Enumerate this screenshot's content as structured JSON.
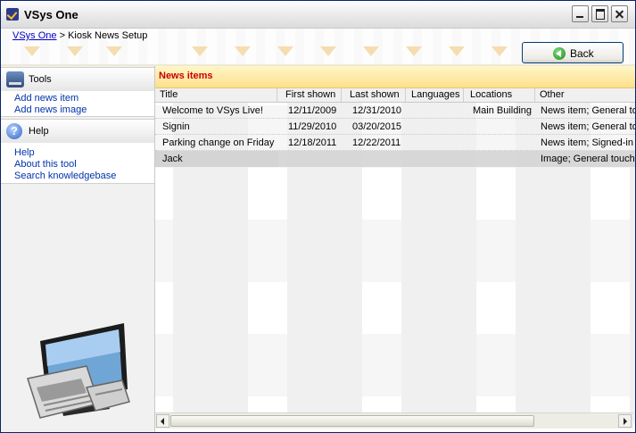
{
  "window": {
    "title": "VSys One"
  },
  "breadcrumb": {
    "root": "VSys One",
    "separator": ">",
    "current": "Kiosk News Setup"
  },
  "toolbar": {
    "back_label": "Back"
  },
  "sidebar": {
    "tools": {
      "title": "Tools",
      "items": [
        {
          "label": "Add news item"
        },
        {
          "label": "Add news image"
        }
      ]
    },
    "help": {
      "title": "Help",
      "items": [
        {
          "label": "Help"
        },
        {
          "label": "About this tool"
        },
        {
          "label": "Search knowledgebase"
        }
      ]
    }
  },
  "news": {
    "title": "News items",
    "columns": [
      "Title",
      "First shown",
      "Last shown",
      "Languages",
      "Locations",
      "Other"
    ],
    "rows": [
      {
        "title": "Welcome to VSys Live!",
        "first_shown": "12/11/2009",
        "last_shown": "12/31/2010",
        "languages": "",
        "locations": "Main Building",
        "other": "News item; General to"
      },
      {
        "title": "Signin",
        "first_shown": "11/29/2010",
        "last_shown": "03/20/2015",
        "languages": "",
        "locations": "",
        "other": "News item; General to"
      },
      {
        "title": "Parking change on Friday",
        "first_shown": "12/18/2011",
        "last_shown": "12/22/2011",
        "languages": "",
        "locations": "",
        "other": "News item; Signed-in"
      },
      {
        "title": "Jack",
        "first_shown": "",
        "last_shown": "",
        "languages": "",
        "locations": "",
        "other": "Image; General touch"
      }
    ],
    "selected_row_index": 3
  },
  "colors": {
    "header_title": "#cc0000",
    "link": "#0033aa",
    "breadcrumb_link": "#0000cc"
  }
}
